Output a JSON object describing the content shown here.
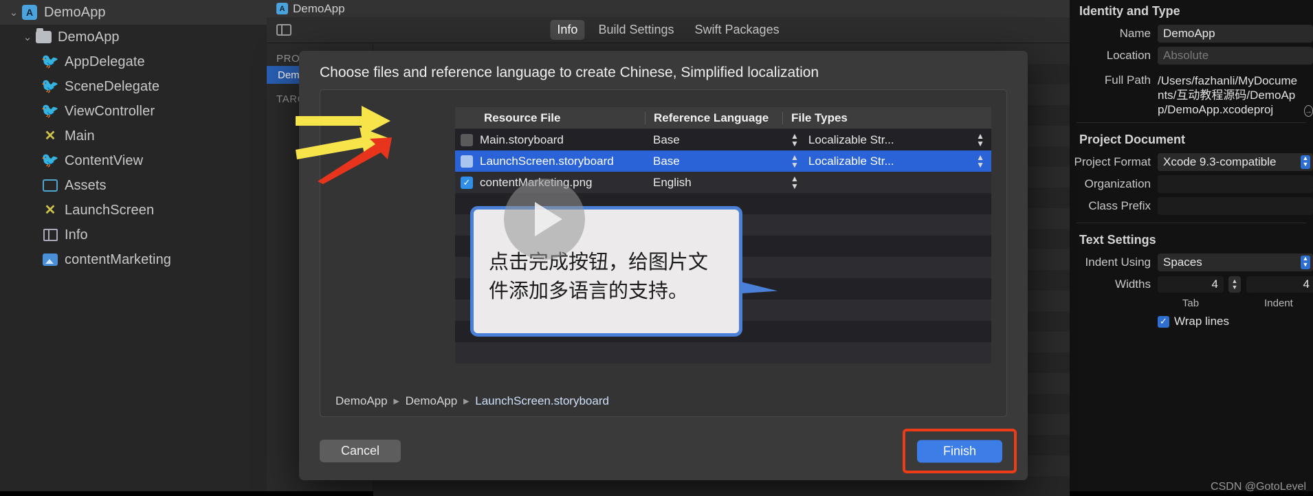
{
  "navigator": {
    "items": [
      {
        "label": "DemoApp",
        "icon": "xcodeproj-icon",
        "depth": 0,
        "chevron": "⌄",
        "selected": true
      },
      {
        "label": "DemoApp",
        "icon": "folder-icon",
        "depth": 1,
        "chevron": "⌄",
        "selected": false
      },
      {
        "label": "AppDelegate",
        "icon": "swift-icon",
        "depth": 2,
        "chevron": "",
        "selected": false
      },
      {
        "label": "SceneDelegate",
        "icon": "swift-icon",
        "depth": 2,
        "chevron": "",
        "selected": false
      },
      {
        "label": "ViewController",
        "icon": "swift-icon",
        "depth": 2,
        "chevron": "",
        "selected": false
      },
      {
        "label": "Main",
        "icon": "storyboard-icon",
        "depth": 2,
        "chevron": "",
        "selected": false
      },
      {
        "label": "ContentView",
        "icon": "swift-icon",
        "depth": 2,
        "chevron": "",
        "selected": false
      },
      {
        "label": "Assets",
        "icon": "assets-icon",
        "depth": 2,
        "chevron": "",
        "selected": false
      },
      {
        "label": "LaunchScreen",
        "icon": "storyboard-icon",
        "depth": 2,
        "chevron": "",
        "selected": false
      },
      {
        "label": "Info",
        "icon": "plist-icon",
        "depth": 2,
        "chevron": "",
        "selected": false
      },
      {
        "label": "contentMarketing",
        "icon": "image-icon",
        "depth": 2,
        "chevron": "",
        "selected": false
      }
    ]
  },
  "editor": {
    "title": "DemoApp",
    "tabs": [
      {
        "label": "Info",
        "active": true
      },
      {
        "label": "Build Settings",
        "active": false
      },
      {
        "label": "Swift Packages",
        "active": false
      }
    ],
    "project_list": {
      "project_header": "PROJECT",
      "project_item": "DemoApp",
      "targets_header": "TARGETS"
    }
  },
  "sheet": {
    "title": "Choose files and reference language to create Chinese, Simplified localization",
    "table": {
      "columns": [
        "Resource File",
        "Reference Language",
        "File Types"
      ],
      "rows": [
        {
          "checked": false,
          "checkbox_style": "grey",
          "resource_file": "Main.storyboard",
          "reference_language": "Base",
          "file_type": "Localizable Str...",
          "selected": false
        },
        {
          "checked": false,
          "checkbox_style": "light",
          "resource_file": "LaunchScreen.storyboard",
          "reference_language": "Base",
          "file_type": "Localizable Str...",
          "selected": true
        },
        {
          "checked": true,
          "checkbox_style": "on",
          "resource_file": "contentMarketing.png",
          "reference_language": "English",
          "file_type": "",
          "selected": false
        }
      ],
      "check_glyph": "✓",
      "stepper_glyph_up": "▴",
      "stepper_glyph_down": "▾"
    },
    "breadcrumb": {
      "parts": [
        "DemoApp",
        "DemoApp",
        "LaunchScreen.storyboard"
      ],
      "separator": "▸"
    },
    "cancel_label": "Cancel",
    "finish_label": "Finish",
    "finish_highlight_color": "#ee3b18"
  },
  "callout": {
    "text": "点击完成按钮，给图片文件添加多语言的支持。",
    "border_color": "#4a80d8"
  },
  "inspector": {
    "sections": {
      "identity": {
        "title": "Identity and Type",
        "name_label": "Name",
        "name_value": "DemoApp",
        "location_label": "Location",
        "location_value": "Absolute",
        "fullpath_label": "Full Path",
        "fullpath_value": "/Users/fazhanli/MyDocuments/互动教程源码/DemoApp/DemoApp.xcodeproj"
      },
      "project_document": {
        "title": "Project Document",
        "format_label": "Project Format",
        "format_value": "Xcode 9.3-compatible",
        "org_label": "Organization",
        "org_value": "",
        "prefix_label": "Class Prefix",
        "prefix_value": ""
      },
      "text_settings": {
        "title": "Text Settings",
        "indent_label": "Indent Using",
        "indent_value": "Spaces",
        "widths_label": "Widths",
        "tab_value": "4",
        "indent_value_num": "4",
        "tab_sublabel": "Tab",
        "indent_sublabel": "Indent",
        "wrap_label": "Wrap lines",
        "wrap_checked": true
      }
    }
  },
  "annotations": {
    "yellow_color": "#f7e34a",
    "red_color": "#e8341c"
  },
  "watermark": "CSDN @GotoLevel"
}
